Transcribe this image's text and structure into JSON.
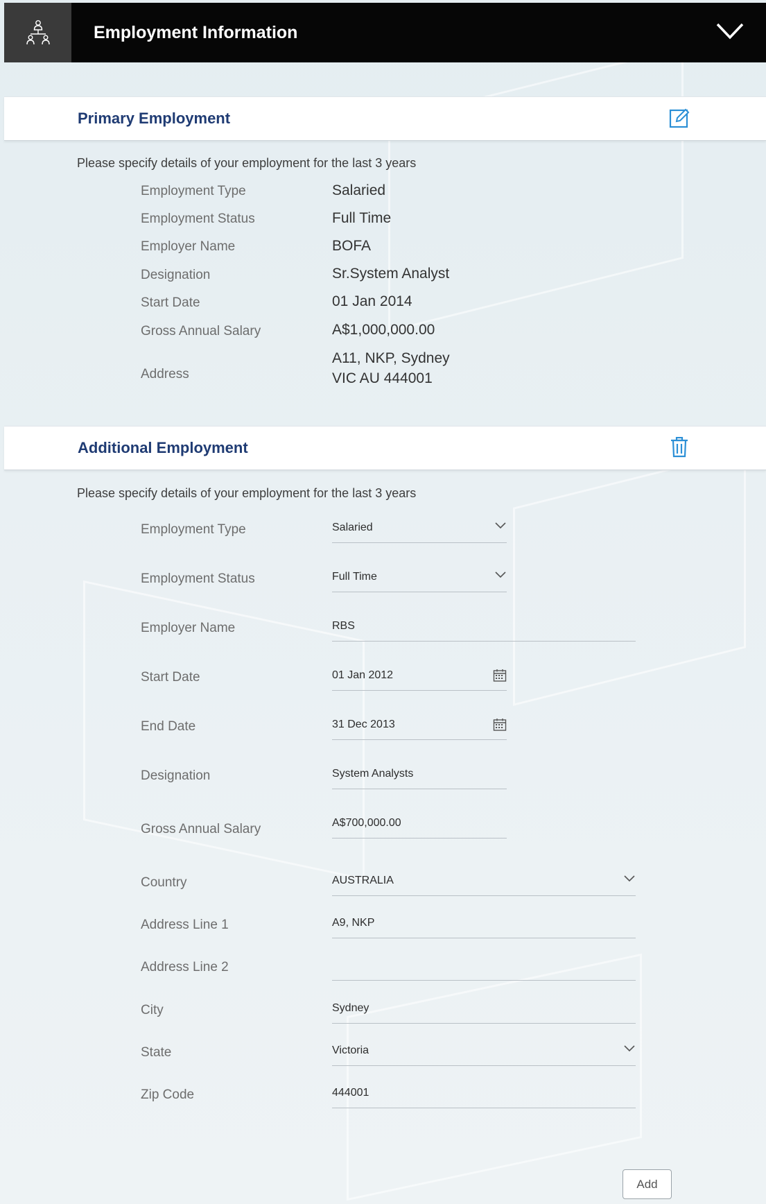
{
  "header": {
    "title": "Employment Information",
    "icon": "team-hierarchy-icon"
  },
  "primary": {
    "title": "Primary Employment",
    "intro": "Please specify details of your employment for the last 3 years",
    "rows": [
      {
        "label": "Employment Type",
        "value": "Salaried"
      },
      {
        "label": "Employment Status",
        "value": "Full Time"
      },
      {
        "label": "Employer Name",
        "value": "BOFA"
      },
      {
        "label": "Designation",
        "value": "Sr.System Analyst"
      },
      {
        "label": "Start Date",
        "value": "01 Jan 2014"
      },
      {
        "label": "Gross Annual Salary",
        "value": "A$1,000,000.00"
      }
    ],
    "address": {
      "label": "Address",
      "line1": "A11, NKP, Sydney",
      "line2": "VIC AU 444001"
    }
  },
  "additional": {
    "title": "Additional Employment",
    "intro": "Please specify details of your employment for the last 3 years",
    "fields": {
      "employment_type": {
        "label": "Employment Type",
        "value": "Salaried"
      },
      "employment_status": {
        "label": "Employment Status",
        "value": "Full Time"
      },
      "employer_name": {
        "label": "Employer Name",
        "value": "RBS"
      },
      "start_date": {
        "label": "Start Date",
        "value": "01 Jan 2012"
      },
      "end_date": {
        "label": "End Date",
        "value": "31 Dec 2013"
      },
      "designation": {
        "label": "Designation",
        "value": "System Analysts"
      },
      "gross_salary": {
        "label": "Gross Annual Salary",
        "value": "A$700,000.00"
      },
      "country": {
        "label": "Country",
        "value": "AUSTRALIA"
      },
      "address_line1": {
        "label": "Address Line 1",
        "value": "A9, NKP"
      },
      "address_line2": {
        "label": "Address Line 2",
        "value": ""
      },
      "city": {
        "label": "City",
        "value": "Sydney"
      },
      "state": {
        "label": "State",
        "value": "Victoria"
      },
      "zip": {
        "label": "Zip Code",
        "value": "444001"
      }
    },
    "add_label": "Add"
  },
  "colors": {
    "header_bg": "#060606",
    "section_title": "#1f3b73",
    "accent_icon": "#2b8fd6"
  }
}
